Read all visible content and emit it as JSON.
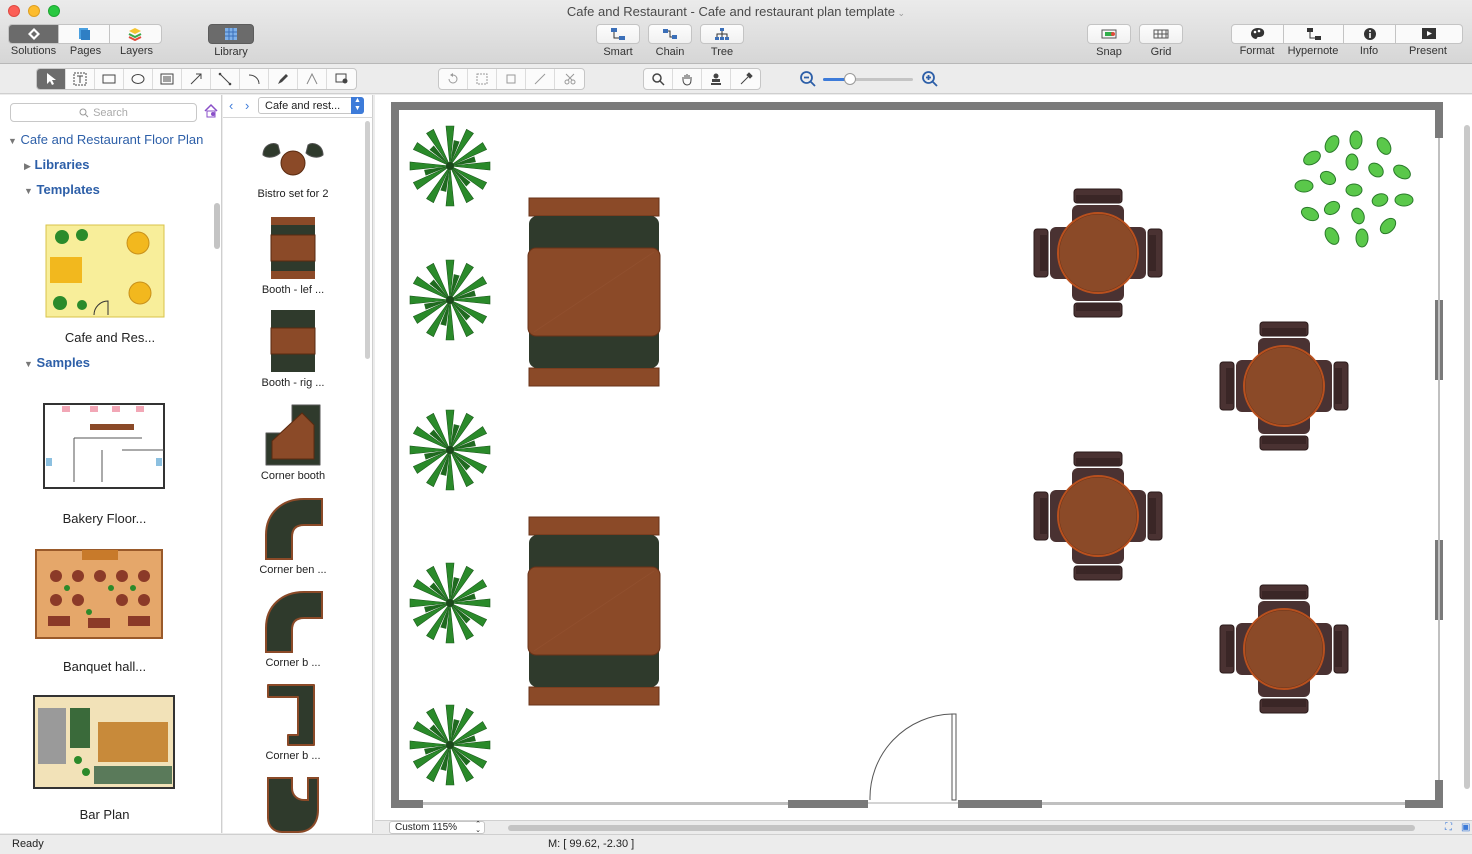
{
  "window": {
    "title": "Cafe and Restaurant - Cafe and restaurant plan template"
  },
  "toolbar": {
    "solutions": "Solutions",
    "pages": "Pages",
    "layers": "Layers",
    "library": "Library",
    "smart": "Smart",
    "chain": "Chain",
    "tree": "Tree",
    "snap": "Snap",
    "grid": "Grid",
    "format": "Format",
    "hypernote": "Hypernote",
    "info": "Info",
    "present": "Present"
  },
  "left_panel": {
    "search_placeholder": "Search",
    "root": "Cafe and Restaurant Floor Plan",
    "libraries": "Libraries",
    "templates": "Templates",
    "samples": "Samples",
    "template_items": [
      {
        "label": "Cafe and Res..."
      }
    ],
    "sample_items": [
      {
        "label": "Bakery Floor..."
      },
      {
        "label": "Banquet hall..."
      },
      {
        "label": "Bar Plan"
      }
    ]
  },
  "library_panel": {
    "selector": "Cafe and rest...",
    "items": [
      {
        "label": "Bistro set for 2"
      },
      {
        "label": "Booth - lef ..."
      },
      {
        "label": "Booth - rig ..."
      },
      {
        "label": "Corner booth"
      },
      {
        "label": "Corner ben ..."
      },
      {
        "label": "Corner b ..."
      },
      {
        "label": "Corner b ..."
      }
    ]
  },
  "zoom": {
    "label": "Custom 115%",
    "slider_fraction": 0.3
  },
  "status": {
    "text": "Ready",
    "mouse": "M: [ 99.62, -2.30 ]"
  },
  "colors": {
    "wood": "#8b4a28",
    "upholstery": "#2f3a2c",
    "chair": "#4a3232",
    "plant": "#2c8a2a",
    "wall": "#7a7a7a",
    "link": "#2d5fa8"
  }
}
